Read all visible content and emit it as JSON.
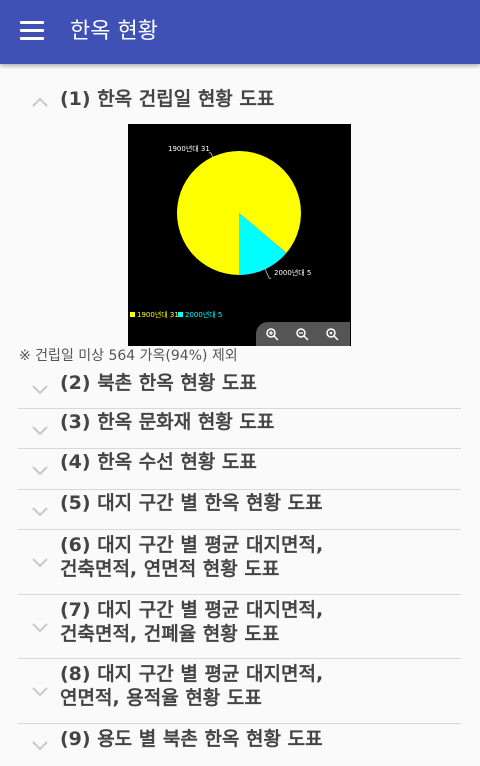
{
  "app": {
    "title": "한옥 현황"
  },
  "sections": [
    {
      "title": "(1) 한옥 건립일 현황 도표",
      "expanded": true
    },
    {
      "title": "(2) 북촌 한옥 현황 도표"
    },
    {
      "title": "(3) 한옥 문화재 현황 도표"
    },
    {
      "title": "(4) 한옥 수선 현황 도표"
    },
    {
      "title": "(5) 대지 구간 별 한옥 현황 도표"
    },
    {
      "title_line1": "(6) 대지 구간 별 평균 대지면적,",
      "title_line2": "건축면적, 연면적 현황 도표"
    },
    {
      "title_line1": "(7) 대지 구간 별 평균 대지면적,",
      "title_line2": "건축면적, 건폐율 현황 도표"
    },
    {
      "title_line1": "(8) 대지 구간 별 평균 대지면적,",
      "title_line2": "연면적, 용적율 현황 도표"
    },
    {
      "title": "(9) 용도 별 북촌 한옥 현황 도표"
    }
  ],
  "note": "※ 건립일 미상 564 가옥(94%) 제외",
  "chart_data": {
    "type": "pie",
    "categories": [
      "1900년대",
      "2000년대"
    ],
    "values": [
      31,
      5
    ],
    "colors": [
      "#ffff00",
      "#00ffff"
    ],
    "slice_labels": [
      "1900년대 31",
      "2000년대 5"
    ],
    "legend": [
      "1900년대 31",
      "2000년대 5"
    ],
    "legend_position": "bottom-left",
    "background": "#000000"
  },
  "zoom": {
    "in_icon": "zoom-in-icon",
    "out_icon": "zoom-out-icon",
    "reset_icon": "zoom-reset-icon"
  }
}
